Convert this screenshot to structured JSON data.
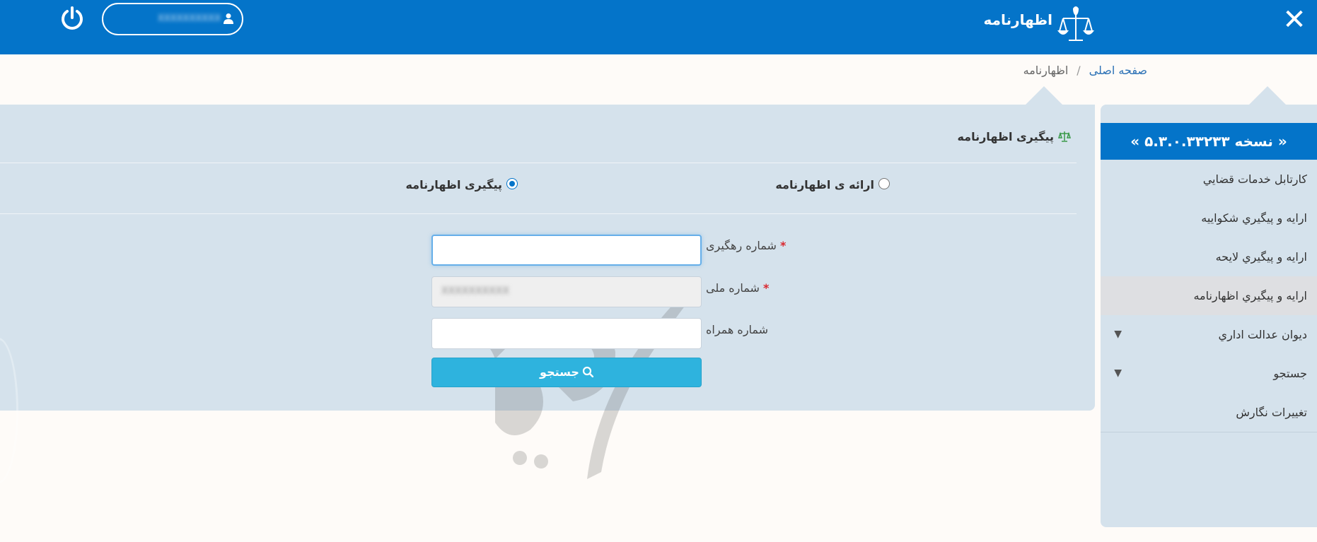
{
  "header": {
    "app_title": "اظهارنامه",
    "close_icon": "close-icon",
    "power_icon": "power-icon",
    "user_icon": "user-icon",
    "user_name": "XXXXXXXXXX"
  },
  "breadcrumb": {
    "home": "صفحه اصلی",
    "separator": "/",
    "current": "اظهارنامه"
  },
  "sidebar": {
    "version": "« نسخه ۵.۳.۰.۳۳۲۳۳ »",
    "items": [
      {
        "label": "كارتابل خدمات قضايي"
      },
      {
        "label": "ارايه و پيگيري شكواييه"
      },
      {
        "label": "ارايه و پيگيري لايحه"
      },
      {
        "label": "ارايه و پيگيري اظهارنامه",
        "active": true
      },
      {
        "label": "ديوان عدالت اداري",
        "has_submenu": true
      },
      {
        "label": "جستجو",
        "has_submenu": true
      },
      {
        "label": "تغییرات نگارش"
      }
    ]
  },
  "main": {
    "title": "پیگیری اظهارنامه",
    "options": [
      {
        "label": "ارائه ی اظهارنامه",
        "checked": false
      },
      {
        "label": "پیگیری اظهارنامه",
        "checked": true
      }
    ],
    "fields": [
      {
        "label": "شماره رهگیری",
        "required": true,
        "value": ""
      },
      {
        "label": "شماره ملی",
        "required": true,
        "value": "XXXXXXXXXX"
      },
      {
        "label": "شماره همراه",
        "required": false,
        "value": ""
      }
    ],
    "required_mark": "*",
    "search_button": "جستجو"
  },
  "colors": {
    "header_blue": "#0474c9",
    "panel_bg": "#d5e2ec",
    "button": "#2eb3de",
    "required": "#d9272e"
  }
}
